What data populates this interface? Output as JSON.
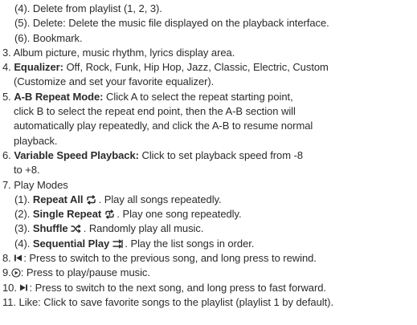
{
  "lines": {
    "l1": "(4). Delete from playlist (1, 2, 3).",
    "l2": "(5). Delete: Delete the music file displayed on the playback interface.",
    "l3": "(6). Bookmark.",
    "l4": "3. Album picture, music rhythm, lyrics display area.",
    "l5_num": "4.",
    "l5_bold": "Equalizer:",
    "l5_text": "Off, Rock, Funk, Hip Hop, Jazz, Classic, Electric, Custom",
    "l6": "(Customize and set your favorite equalizer).",
    "l7_num": "5.",
    "l7_bold": "A-B Repeat Mode:",
    "l7_text": "Click A to select the repeat starting point,",
    "l8": "click B to select the repeat end point, then the A-B section will",
    "l9": "automatically play repeatedly, and click the A-B to resume normal",
    "l10": "playback.",
    "l11_num": "6.",
    "l11_bold": "Variable Speed Playback:",
    "l11_text": "Click to set playback speed from -8",
    "l12": "to +8.",
    "l13": "7. Play Modes",
    "l14_num": "(1).",
    "l14_bold": "Repeat All",
    "l14_text": ". Play all songs repeatedly.",
    "l15_num": "(2).",
    "l15_bold": "Single Repeat",
    "l15_text": ". Play one song repeatedly.",
    "l16_num": "(3).",
    "l16_bold": "Shuffle",
    "l16_text": ". Randomly play all music.",
    "l17_num": "(4).",
    "l17_bold": "Sequential Play",
    "l17_text": ". Play the list songs in order.",
    "l18_num": "8.",
    "l18_text": ": Press to switch to the previous song, and long press to rewind.",
    "l19_num": "9.",
    "l19_text": ": Press to play/pause music.",
    "l20_num": "10.",
    "l20_text": ": Press to switch to the next song, and long press to fast forward.",
    "l21": "11. Like: Click to save favorite songs to the playlist (playlist 1 by default)."
  },
  "icons": {
    "repeat_all": "repeat-all-icon",
    "single_repeat": "single-repeat-icon",
    "shuffle": "shuffle-icon",
    "sequential": "sequential-play-icon",
    "previous": "previous-track-icon",
    "play_pause": "play-pause-icon",
    "next": "next-track-icon"
  }
}
